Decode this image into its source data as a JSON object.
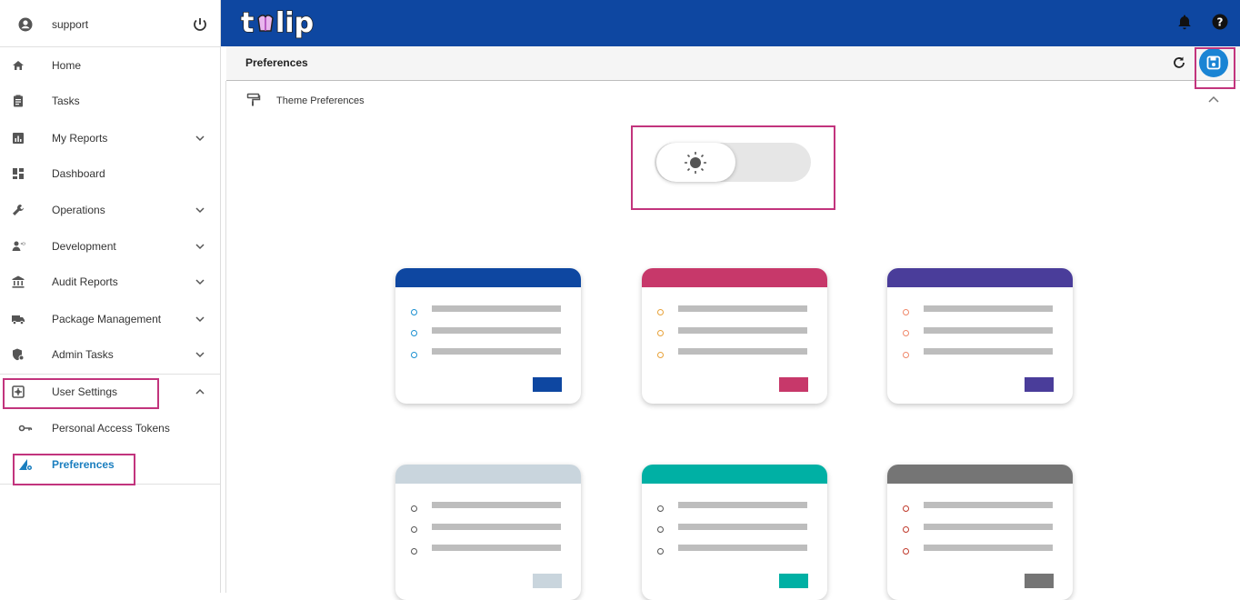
{
  "user": {
    "name": "support"
  },
  "sidebar": {
    "items": [
      {
        "label": "Home"
      },
      {
        "label": "Tasks"
      },
      {
        "label": "My Reports"
      },
      {
        "label": "Dashboard"
      },
      {
        "label": "Operations"
      },
      {
        "label": "Development"
      },
      {
        "label": "Audit Reports"
      },
      {
        "label": "Package Management"
      },
      {
        "label": "Admin Tasks"
      },
      {
        "label": "User Settings"
      },
      {
        "label": "Personal Access Tokens"
      },
      {
        "label": "Preferences"
      }
    ]
  },
  "header": {
    "logo_text": "tulip"
  },
  "page": {
    "title": "Preferences"
  },
  "section": {
    "title": "Theme Preferences"
  },
  "theme": {
    "mode": "light",
    "colors": {
      "brand": "#0e47a1",
      "highlight": "#c2347d",
      "active": "#1a7ebf"
    },
    "cards": [
      {
        "band": "#0e47a1",
        "dots": [
          "#1a8fd0",
          "#1a8fd0",
          "#1a8fd0"
        ]
      },
      {
        "band": "#c7386a",
        "dots": [
          "#e8a23a",
          "#e8a23a",
          "#e8a23a"
        ]
      },
      {
        "band": "#4a3d9a",
        "dots": [
          "#f0886a",
          "#f0886a",
          "#f0886a"
        ]
      },
      {
        "band": "#c9d5dd",
        "dots": [
          "#555555",
          "#555555",
          "#555555"
        ]
      },
      {
        "band": "#00b0a4",
        "dots": [
          "#555555",
          "#555555",
          "#555555"
        ]
      },
      {
        "band": "#757575",
        "dots": [
          "#c0392b",
          "#c0392b",
          "#c0392b"
        ]
      }
    ]
  }
}
